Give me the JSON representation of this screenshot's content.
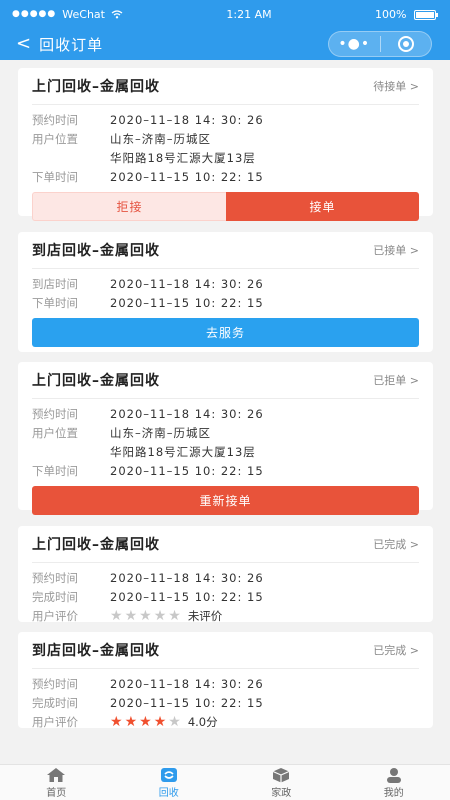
{
  "status_bar": {
    "carrier": "WeChat",
    "time": "1:21 AM",
    "battery": "100%"
  },
  "nav": {
    "back_glyph": "<",
    "title": "回收订单"
  },
  "orders": [
    {
      "title": "上门回收–金属回收",
      "status": "待接单 >",
      "rows": [
        {
          "label": "预约时间",
          "value": "2020–11–18  14: 30: 26"
        },
        {
          "label": "用户位置",
          "value": "山东–济南–历城区"
        },
        {
          "label": "",
          "value": "华阳路18号汇源大厦13层"
        },
        {
          "label": "下单时间",
          "value": "2020–11–15  10: 22: 15"
        }
      ],
      "reject_label": "拒接",
      "accept_label": "接单"
    },
    {
      "title": "到店回收–金属回收",
      "status": "已接单 >",
      "rows": [
        {
          "label": "到店时间",
          "value": "2020–11–18  14: 30: 26"
        },
        {
          "label": "下单时间",
          "value": "2020–11–15  10: 22: 15"
        }
      ],
      "action_label": "去服务"
    },
    {
      "title": "上门回收–金属回收",
      "status": "已拒单 >",
      "rows": [
        {
          "label": "预约时间",
          "value": "2020–11–18  14: 30: 26"
        },
        {
          "label": "用户位置",
          "value": "山东–济南–历城区"
        },
        {
          "label": "",
          "value": "华阳路18号汇源大厦13层"
        },
        {
          "label": "下单时间",
          "value": "2020–11–15  10: 22: 15"
        }
      ],
      "action_label": "重新接单"
    },
    {
      "title": "上门回收–金属回收",
      "status": "已完成 >",
      "rows": [
        {
          "label": "预约时间",
          "value": "2020–11–18  14: 30: 26"
        },
        {
          "label": "完成时间",
          "value": "2020–11–15  10: 22: 15"
        }
      ],
      "rating_label": "用户评价",
      "rating_stars": 0,
      "rating_text": "未评价"
    },
    {
      "title": "到店回收–金属回收",
      "status": "已完成 >",
      "rows": [
        {
          "label": "预约时间",
          "value": "2020–11–18  14: 30: 26"
        },
        {
          "label": "完成时间",
          "value": "2020–11–15  10: 22: 15"
        }
      ],
      "rating_label": "用户评价",
      "rating_stars": 4,
      "rating_text": "4.0分"
    }
  ],
  "tabbar": [
    {
      "label": "首页",
      "icon": "home-icon"
    },
    {
      "label": "回收",
      "icon": "recycle-icon"
    },
    {
      "label": "家政",
      "icon": "box-icon"
    },
    {
      "label": "我的",
      "icon": "user-icon"
    }
  ],
  "colors": {
    "primary": "#2f9bec",
    "danger": "#e8533a",
    "star_on": "#f0502f",
    "star_off": "#c8c8c8"
  }
}
